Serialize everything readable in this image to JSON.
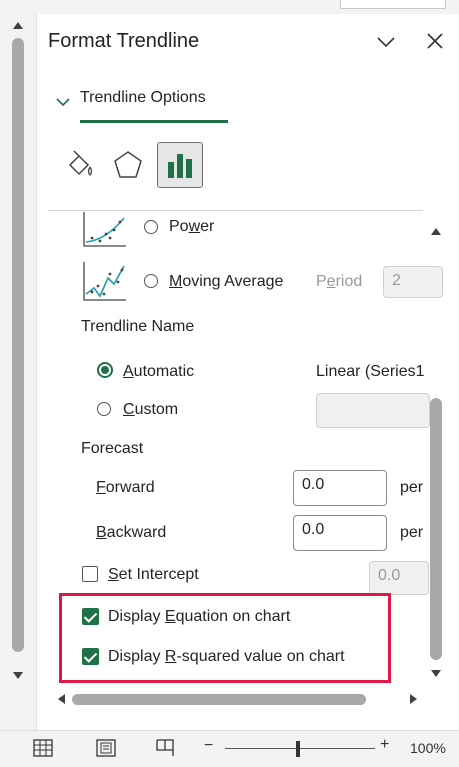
{
  "pane": {
    "title": "Format Trendline",
    "tab_label": "Trendline Options"
  },
  "trend_types": [
    {
      "label": "Power",
      "key": "w",
      "before": "Po",
      "after": "er"
    },
    {
      "label": "Moving Average",
      "key": "M",
      "before": "",
      "after": "oving Average"
    }
  ],
  "period": {
    "label_before": "P",
    "key": "e",
    "label_after": "riod",
    "value": "2"
  },
  "trendline_name": {
    "heading": "Trendline Name",
    "automatic": {
      "key": "A",
      "rest": "utomatic",
      "value": "Linear (Series1"
    },
    "custom": {
      "key": "C",
      "rest": "ustom",
      "value": ""
    }
  },
  "forecast": {
    "heading": "Forecast",
    "forward": {
      "key": "F",
      "rest": "orward",
      "value": "0.0",
      "unit": "per"
    },
    "backward": {
      "key": "B",
      "rest": "ackward",
      "value": "0.0",
      "unit": "per"
    }
  },
  "intercept": {
    "key": "S",
    "rest": "et Intercept",
    "value": "0.0",
    "checked": false
  },
  "display_equation": {
    "before": "Display ",
    "key": "E",
    "after": "quation on chart",
    "checked": true
  },
  "display_r2": {
    "before": "Display ",
    "key": "R",
    "after": "-squared value on chart",
    "checked": true
  },
  "status": {
    "zoom_minus": "−",
    "zoom_plus": "+",
    "zoom": "100%"
  },
  "colors": {
    "accent": "#1e7145",
    "highlight": "#e0184a"
  }
}
